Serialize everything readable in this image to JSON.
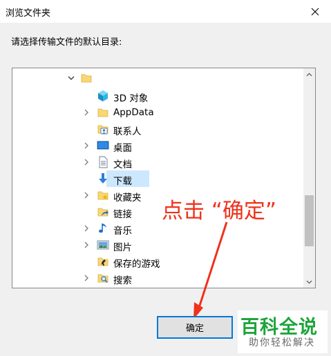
{
  "window": {
    "title": "浏览文件夹"
  },
  "prompt": "请选择传输文件的默认目录:",
  "tree": {
    "items": [
      {
        "label": "",
        "icon": "folder-icon",
        "expander": "expanded"
      },
      {
        "label": "3D 对象",
        "icon": "3d-objects-icon",
        "expander": "none"
      },
      {
        "label": "AppData",
        "icon": "folder-icon",
        "expander": "collapsed"
      },
      {
        "label": "联系人",
        "icon": "contacts-icon",
        "expander": "none"
      },
      {
        "label": "桌面",
        "icon": "desktop-icon",
        "expander": "collapsed"
      },
      {
        "label": "文档",
        "icon": "documents-icon",
        "expander": "collapsed"
      },
      {
        "label": "下载",
        "icon": "downloads-icon",
        "expander": "none",
        "selected": true
      },
      {
        "label": "收藏夹",
        "icon": "favorites-icon",
        "expander": "collapsed"
      },
      {
        "label": "链接",
        "icon": "links-icon",
        "expander": "none"
      },
      {
        "label": "音乐",
        "icon": "music-icon",
        "expander": "collapsed"
      },
      {
        "label": "图片",
        "icon": "pictures-icon",
        "expander": "collapsed"
      },
      {
        "label": "保存的游戏",
        "icon": "saved-games-icon",
        "expander": "none"
      },
      {
        "label": "搜索",
        "icon": "searches-icon",
        "expander": "collapsed"
      }
    ]
  },
  "annotation": "点击 “确定”",
  "buttons": {
    "ok": "确定"
  },
  "watermark": {
    "title": "百科全说",
    "subtitle": "助你轻松解决"
  },
  "colors": {
    "accent": "#0078d7",
    "annotation": "#f0311b",
    "selection": "#cce8ff",
    "watermark": "#1da53a"
  }
}
